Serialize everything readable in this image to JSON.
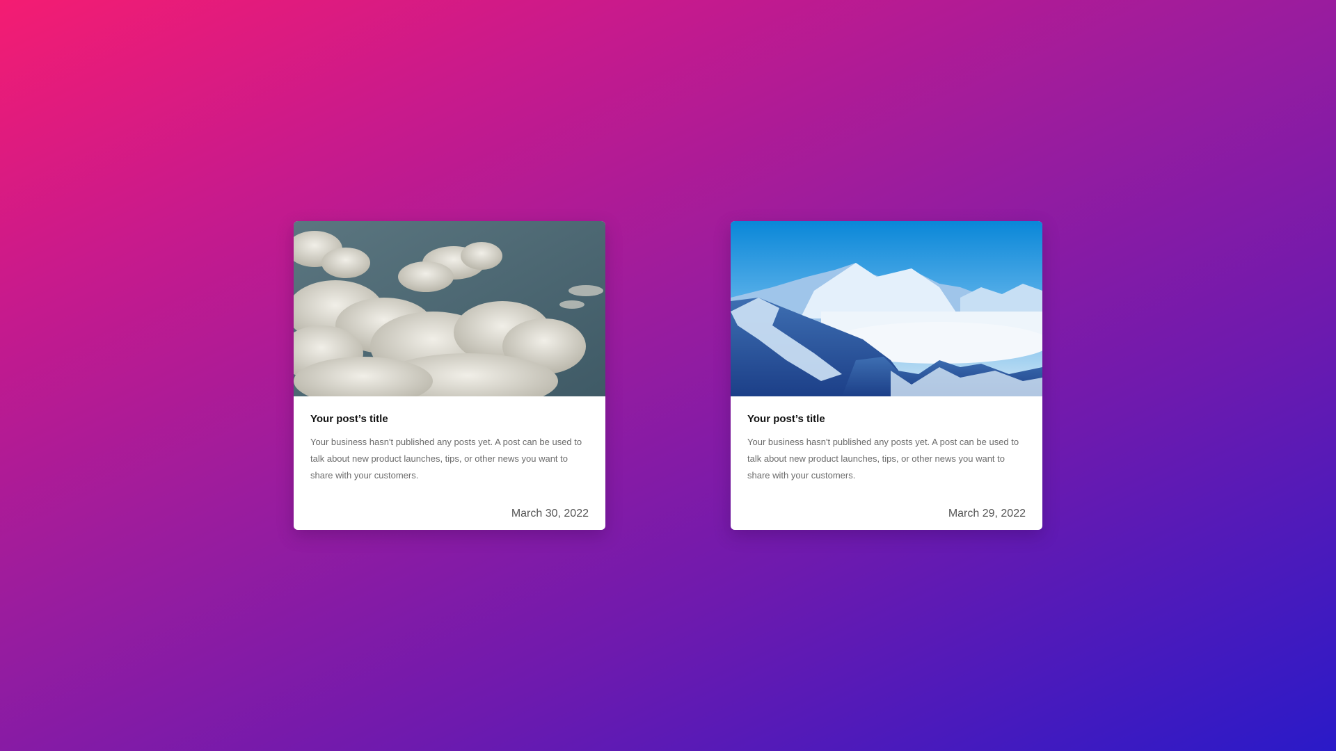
{
  "posts": [
    {
      "image": "cloudy-sky-photo",
      "title": "Your post’s title",
      "excerpt": "Your business hasn't published any posts yet. A post can be used to talk about new product launches, tips, or other news you want to share with your customers.",
      "date": "March 30, 2022"
    },
    {
      "image": "snowy-mountains-photo",
      "title": "Your post’s title",
      "excerpt": "Your business hasn't published any posts yet. A post can be used to talk about new product launches, tips, or other news you want to share with your customers.",
      "date": "March 29, 2022"
    }
  ]
}
